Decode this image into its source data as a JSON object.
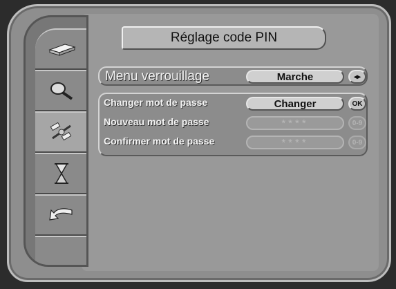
{
  "title": "Réglage code PIN",
  "sidebar": {
    "items": [
      {
        "icon": "receiver-box-icon"
      },
      {
        "icon": "magnifier-icon"
      },
      {
        "icon": "satellite-icon"
      },
      {
        "icon": "hourglass-icon"
      },
      {
        "icon": "exit-arrow-icon"
      },
      {
        "icon": "empty"
      }
    ]
  },
  "lock_menu": {
    "label": "Menu verrouillage",
    "value": "Marche",
    "nav_hint": "◂▸"
  },
  "password": {
    "change": {
      "label": "Changer mot de passe",
      "value": "Changer",
      "hint": "OK"
    },
    "new": {
      "label": "Nouveau mot de passe",
      "value": "****",
      "hint": "0-9"
    },
    "confirm": {
      "label": "Confirmer mot de passe",
      "value": "****",
      "hint": "0-9"
    }
  }
}
